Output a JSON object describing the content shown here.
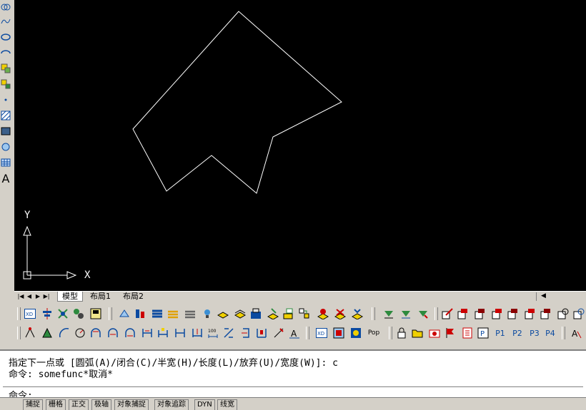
{
  "left_toolbar": {
    "icons": [
      "cloud-icon",
      "spline-icon",
      "ellipse-icon",
      "ellipse-arc-icon",
      "insert-block-icon",
      "make-block-icon",
      "point-icon",
      "hatch-icon",
      "region-icon",
      "table-icon",
      "text-icon"
    ],
    "text_tool_label": "A"
  },
  "canvas": {
    "background": "#000000",
    "ucs": {
      "y_label": "Y",
      "x_label": "X"
    }
  },
  "layout_tabs": {
    "tabs": [
      "模型",
      "布局1",
      "布局2"
    ],
    "active": "模型"
  },
  "toolbar_row1": {
    "icons": [
      "xref-icon",
      "align-icon",
      "explode-icon",
      "properties-icon",
      "layer-manager-icon",
      "layer-icon-1",
      "layer-icon-2",
      "layer-icon-3",
      "layer-icon-4",
      "layer-icon-5",
      "layer-icon-6",
      "layer-icon-7",
      "layer-icon-8",
      "layer-icon-9",
      "layer-icon-10",
      "layer-icon-11",
      "down-arrow-green-icon-1",
      "down-arrow-green-icon-2",
      "down-arrow-green-icon-3",
      "modify-icon-1",
      "modify-icon-2",
      "modify-icon-3",
      "modify-icon-4",
      "modify-icon-5",
      "modify-icon-6",
      "modify-icon-7",
      "modify-icon-8"
    ]
  },
  "toolbar_row2": {
    "icons": [
      "dim-icon-1",
      "dim-icon-2",
      "dim-icon-3",
      "dim-icon-4",
      "dim-icon-5",
      "dim-icon-6",
      "dim-icon-7",
      "dim-icon-8",
      "dim-icon-9",
      "dim-icon-10",
      "dim-icon-11",
      "dim-icon-12",
      "dim-icon-13",
      "dim-icon-14",
      "dim-icon-15",
      "dim-icon-16"
    ],
    "right_labels": [
      "Pop",
      "P1",
      "P2",
      "P3",
      "P4"
    ]
  },
  "command": {
    "history": [
      "指定下一点或 [圆弧(A)/闭合(C)/半宽(H)/长度(L)/放弃(U)/宽度(W)]: c",
      "命令: somefunc*取消*"
    ],
    "prompt": "命令:"
  },
  "statusbar": {
    "buttons": [
      "捕捉",
      "栅格",
      "正交",
      "极轴",
      "对象捕捉",
      "对象追踪",
      "DYN",
      "线宽"
    ]
  },
  "colors": {
    "canvas_bg": "#000000",
    "line_color": "#ffffff",
    "chrome": "#d4d0c8"
  }
}
